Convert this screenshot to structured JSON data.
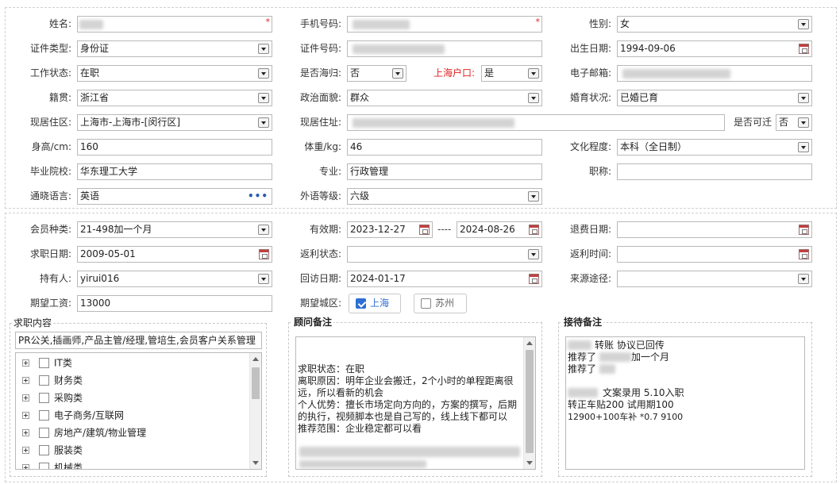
{
  "form": {
    "name_label": "姓名:",
    "name_value": "",
    "required_mark": "*",
    "phone_label": "手机号码:",
    "gender_label": "性别:",
    "gender_value": "女",
    "id_type_label": "证件类型:",
    "id_type_value": "身份证",
    "id_no_label": "证件号码:",
    "birth_label": "出生日期:",
    "birth_value": "1994-09-06",
    "work_status_label": "工作状态:",
    "work_status_value": "在职",
    "returnee_label": "是否海归:",
    "returnee_value": "否",
    "shanghai_hukou_label": "上海户口:",
    "shanghai_hukou_value": "是",
    "email_label": "电子邮箱:",
    "native_label": "籍贯:",
    "native_value": "浙江省",
    "political_label": "政治面貌:",
    "political_value": "群众",
    "marital_label": "婚育状况:",
    "marital_value": "已婚已育",
    "residence_area_label": "现居住区:",
    "residence_area_value": "上海市-上海市-[闵行区]",
    "address_label": "现居住址:",
    "relocate_label": "是否可迁",
    "relocate_value": "否",
    "height_label": "身高/cm:",
    "height_value": "160",
    "weight_label": "体重/kg:",
    "weight_value": "46",
    "education_label": "文化程度:",
    "education_value": "本科（全日制）",
    "school_label": "毕业院校:",
    "school_value": "华东理工大学",
    "major_label": "专业:",
    "major_value": "行政管理",
    "title_label": "职称:",
    "title_value": "",
    "language_label": "通晓语言:",
    "language_value": "英语",
    "foreign_level_label": "外语等级:",
    "foreign_level_value": "六级"
  },
  "membership": {
    "member_type_label": "会员种类:",
    "member_type_value": "21-498加一个月",
    "validity_label": "有效期:",
    "validity_start": "2023-12-27",
    "validity_sep": "----",
    "validity_end": "2024-08-26",
    "refund_date_label": "退费日期:",
    "job_date_label": "求职日期:",
    "job_date_value": "2009-05-01",
    "rebate_status_label": "返利状态:",
    "rebate_time_label": "返利时间:",
    "holder_label": "持有人:",
    "holder_value": "yirui016",
    "visit_date_label": "回访日期:",
    "visit_date_value": "2024-01-17",
    "source_label": "来源途径:",
    "salary_label": "期望工资:",
    "salary_value": "13000",
    "city_label": "期望城区:",
    "city_options": [
      {
        "label": "上海",
        "checked": true
      },
      {
        "label": "苏州",
        "checked": false
      }
    ]
  },
  "job_content": {
    "legend": "求职内容",
    "selected_text": "PR公关,插画师,产品主管/经理,管培生,会员客户关系管理",
    "tree_items": [
      "IT类",
      "财务类",
      "采购类",
      "电子商务/互联网",
      "房地产/建筑/物业管理",
      "服装类",
      "机械类"
    ]
  },
  "advisor_notes": {
    "legend": "顾问备注",
    "lines": [
      "求职状态：在职",
      "离职原因：明年企业会搬迁，2个小时的单程距离很",
      "远，所以看新的机会",
      "个人优势：擅长市场定向方向的，方案的撰写，后期",
      "的执行，视频脚本也是自己写的，线上线下都可以",
      "推荐范围：企业稳定都可以看"
    ]
  },
  "reception_notes": {
    "legend": "接待备注",
    "line1": "转账   协议已回传",
    "line2_prefix": "推荐了",
    "line2_suffix": "加一个月",
    "line3_prefix": "推荐了",
    "line4": "文案录用 5.10入职",
    "line5": "转正车贴200 试用期100",
    "line6": "12900+100车补 *0.7 9100"
  }
}
